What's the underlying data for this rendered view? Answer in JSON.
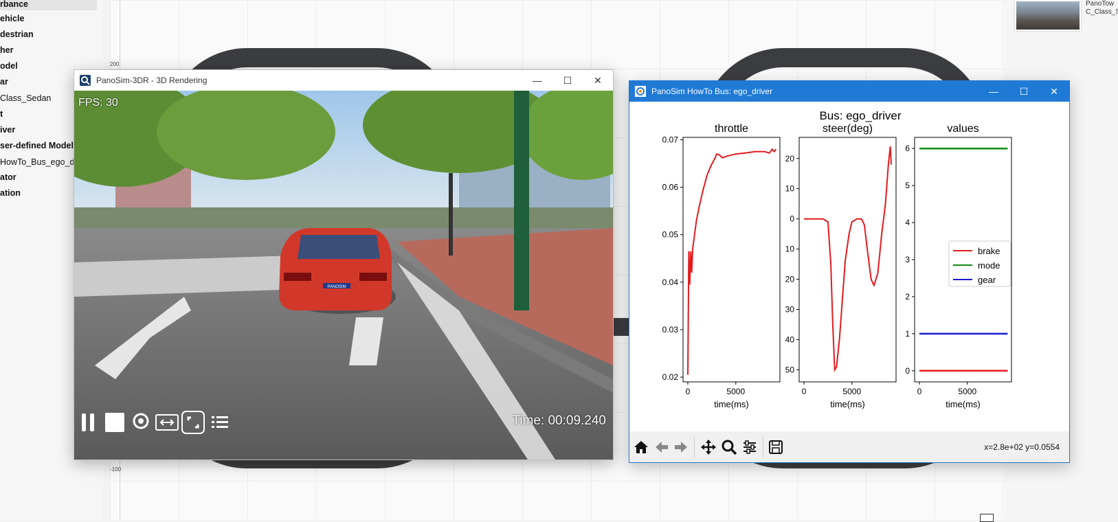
{
  "tree": {
    "items": [
      "rbance",
      "ehicle",
      "destrian",
      "her",
      "odel",
      "ar",
      "Class_Sedan",
      "t",
      "iver",
      "ser-defined Model",
      "HowTo_Bus_ego_d",
      "ator",
      "ation"
    ]
  },
  "canvas": {
    "axis_labels": [
      "200",
      "-100"
    ]
  },
  "right_panel": {
    "thumb_caption_line1": "PanoTow",
    "thumb_caption_line2": "C_Class_S"
  },
  "window_3d": {
    "title": "PanoSim-3DR - 3D Rendering",
    "fps": "FPS: 30",
    "time": "Time: 00:09.240",
    "plate": "PANOSIM"
  },
  "window_plot": {
    "title": "PanoSim HowTo Bus: ego_driver",
    "suptitle": "Bus: ego_driver",
    "coords": "x=2.8e+02 y=0.0554"
  },
  "colors": {
    "titlebar_blue": "#1f7ad6",
    "brake": "#e31a1c",
    "mode": "#138a13",
    "gear": "#1a1ad4",
    "throttle": "#e31a1c",
    "steer": "#e31a1c"
  },
  "icons": [
    "home-icon",
    "back-arrow-icon",
    "forward-arrow-icon",
    "pan-icon",
    "zoom-icon",
    "configure-icon",
    "save-icon",
    "pause-icon",
    "stop-icon",
    "location-icon",
    "camera-view-icon",
    "fullscreen-icon",
    "list-icon"
  ],
  "chart_data": [
    {
      "type": "line",
      "title": "throttle",
      "xlabel": "time(ms)",
      "ylabel": "",
      "xlim": [
        -500,
        9600
      ],
      "ylim": [
        0.019,
        0.0705
      ],
      "xticks": [
        0,
        5000
      ],
      "yticks": [
        0.02,
        0.03,
        0.04,
        0.05,
        0.06,
        0.07
      ],
      "ytick_labels": [
        "0.02",
        "0.03",
        "0.04",
        "0.05",
        "0.06",
        "0.07"
      ],
      "series": [
        {
          "x": [
            0,
            100,
            200,
            300,
            400,
            500,
            700,
            900,
            1200,
            1600,
            2000,
            2400,
            2800,
            3000,
            3300,
            3600,
            4000,
            5000,
            6000,
            7000,
            8000,
            8500,
            8800,
            9000,
            9200
          ],
          "y": [
            0.0205,
            0.0465,
            0.0395,
            0.0465,
            0.042,
            0.047,
            0.05,
            0.053,
            0.056,
            0.0595,
            0.0625,
            0.0645,
            0.066,
            0.067,
            0.0668,
            0.0662,
            0.0665,
            0.067,
            0.0672,
            0.0675,
            0.0675,
            0.0672,
            0.068,
            0.0675,
            0.068
          ]
        }
      ]
    },
    {
      "type": "line",
      "title": "steer(deg)",
      "xlabel": "time(ms)",
      "ylabel": "",
      "xlim": [
        -500,
        9600
      ],
      "ylim": [
        -54,
        27
      ],
      "xticks": [
        0,
        5000
      ],
      "yticks": [
        20,
        10,
        0,
        -10,
        -20,
        -30,
        -40,
        -50
      ],
      "ytick_labels": [
        "20",
        "10",
        "0",
        "10",
        "20",
        "30",
        "40",
        "50"
      ],
      "series": [
        {
          "x": [
            0,
            1000,
            2000,
            2500,
            2800,
            3000,
            3200,
            3400,
            3700,
            4000,
            4300,
            4700,
            5000,
            5500,
            6000,
            6300,
            6600,
            7000,
            7300,
            7700,
            8100,
            8500,
            8800,
            9000,
            9100
          ],
          "y": [
            0,
            0,
            0,
            -1,
            -15,
            -35,
            -50,
            -49,
            -40,
            -27,
            -14,
            -5,
            -1,
            0,
            0,
            -2,
            -10,
            -20,
            -22,
            -18,
            -5,
            5,
            18,
            24,
            18
          ]
        }
      ]
    },
    {
      "type": "line",
      "title": "values",
      "xlabel": "time(ms)",
      "ylabel": "",
      "xlim": [
        -500,
        9600
      ],
      "ylim": [
        -0.3,
        6.3
      ],
      "xticks": [
        0,
        5000
      ],
      "yticks": [
        0,
        1,
        2,
        3,
        4,
        5,
        6
      ],
      "legend": "center-right",
      "series": [
        {
          "name": "brake",
          "x": [
            0,
            9200
          ],
          "y": [
            0,
            0
          ]
        },
        {
          "name": "mode",
          "x": [
            0,
            9200
          ],
          "y": [
            6,
            6
          ]
        },
        {
          "name": "gear",
          "x": [
            0,
            9200
          ],
          "y": [
            1,
            1
          ]
        }
      ]
    }
  ]
}
